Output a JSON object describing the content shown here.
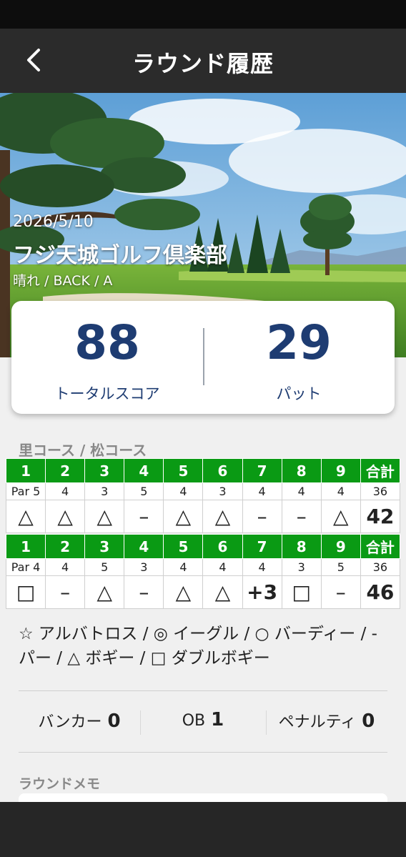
{
  "header": {
    "title": "ラウンド履歴"
  },
  "round": {
    "date": "2026/5/10",
    "course": "フジ天城ゴルフ倶楽部",
    "conditions": "晴れ / BACK / A"
  },
  "summary": {
    "total_score": "88",
    "total_score_label": "トータルスコア",
    "putts": "29",
    "putts_label": "パット"
  },
  "scorecard": {
    "course_label": "里コース / 松コース",
    "total_label": "合計",
    "front": {
      "holes": [
        "1",
        "2",
        "3",
        "4",
        "5",
        "6",
        "7",
        "8",
        "9"
      ],
      "pars": [
        "Par 5",
        "4",
        "3",
        "5",
        "4",
        "3",
        "4",
        "4",
        "4"
      ],
      "par_total": "36",
      "marks": [
        "△",
        "△",
        "△",
        "–",
        "△",
        "△",
        "–",
        "–",
        "△"
      ],
      "score_total": "42"
    },
    "back": {
      "holes": [
        "1",
        "2",
        "3",
        "4",
        "5",
        "6",
        "7",
        "8",
        "9"
      ],
      "pars": [
        "Par 4",
        "4",
        "5",
        "3",
        "4",
        "4",
        "4",
        "3",
        "5"
      ],
      "par_total": "36",
      "marks": [
        "□",
        "–",
        "△",
        "–",
        "△",
        "△",
        "+3",
        "□",
        "–"
      ],
      "score_total": "46"
    }
  },
  "legend": "☆ アルバトロス / ◎ イーグル / ○ バーディー / -パー / △ ボギー / □ ダブルボギー",
  "stats": {
    "bunker_label": "バンカー",
    "bunker_value": "0",
    "ob_label": "OB",
    "ob_value": "1",
    "penalty_label": "ペナルティ",
    "penalty_value": "0"
  },
  "memo": {
    "label": "ラウンドメモ"
  },
  "colors": {
    "hole_header": "#0a9a14",
    "score_accent": "#1e3c72",
    "app_bar": "#2b2b2b"
  },
  "icons": {
    "back": "chevron-left-icon"
  }
}
